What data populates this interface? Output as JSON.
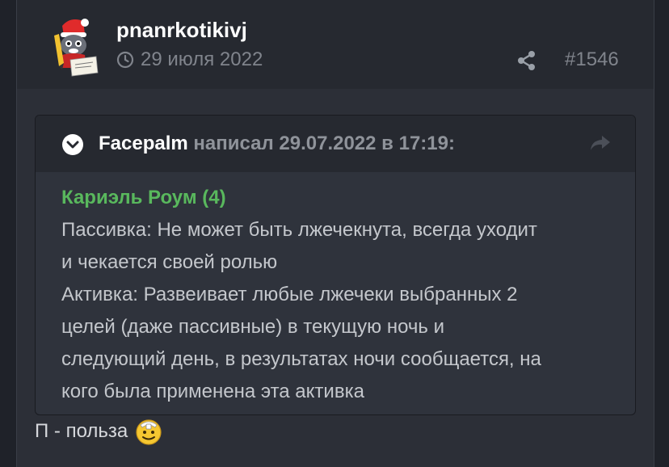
{
  "post": {
    "username": "pnanrkotikivj",
    "date": "29 июля 2022",
    "number": "#1546",
    "icons": {
      "date": "clock-icon",
      "share": "share-icon"
    }
  },
  "quote": {
    "author": "Facepalm",
    "wrote_label": "написал 29.07.2022 в 17:19:",
    "title": "Кариэль Роум (4)",
    "lines": [
      "Пассивка: Не может быть лжечекнута, всегда уходит",
      "и чекается своей ролью",
      "Активка: Развеивает любые лжечеки выбранных 2",
      "целей (даже пассивные) в текущую ночь и",
      "следующий день, в результатах ночи сообщается, на",
      "кого была применена эта активка"
    ],
    "icons": {
      "toggle": "chevron-down-icon",
      "jump": "jump-arrow-icon"
    }
  },
  "reply": {
    "text": "П - польза",
    "emoji": "smiley-icon"
  },
  "colors": {
    "background": "#1f2229",
    "post_bg": "#2c2f37",
    "header_bg": "#262930",
    "quote_title": "#59b85d",
    "text": "#c4c7cc",
    "muted": "#80848c"
  }
}
